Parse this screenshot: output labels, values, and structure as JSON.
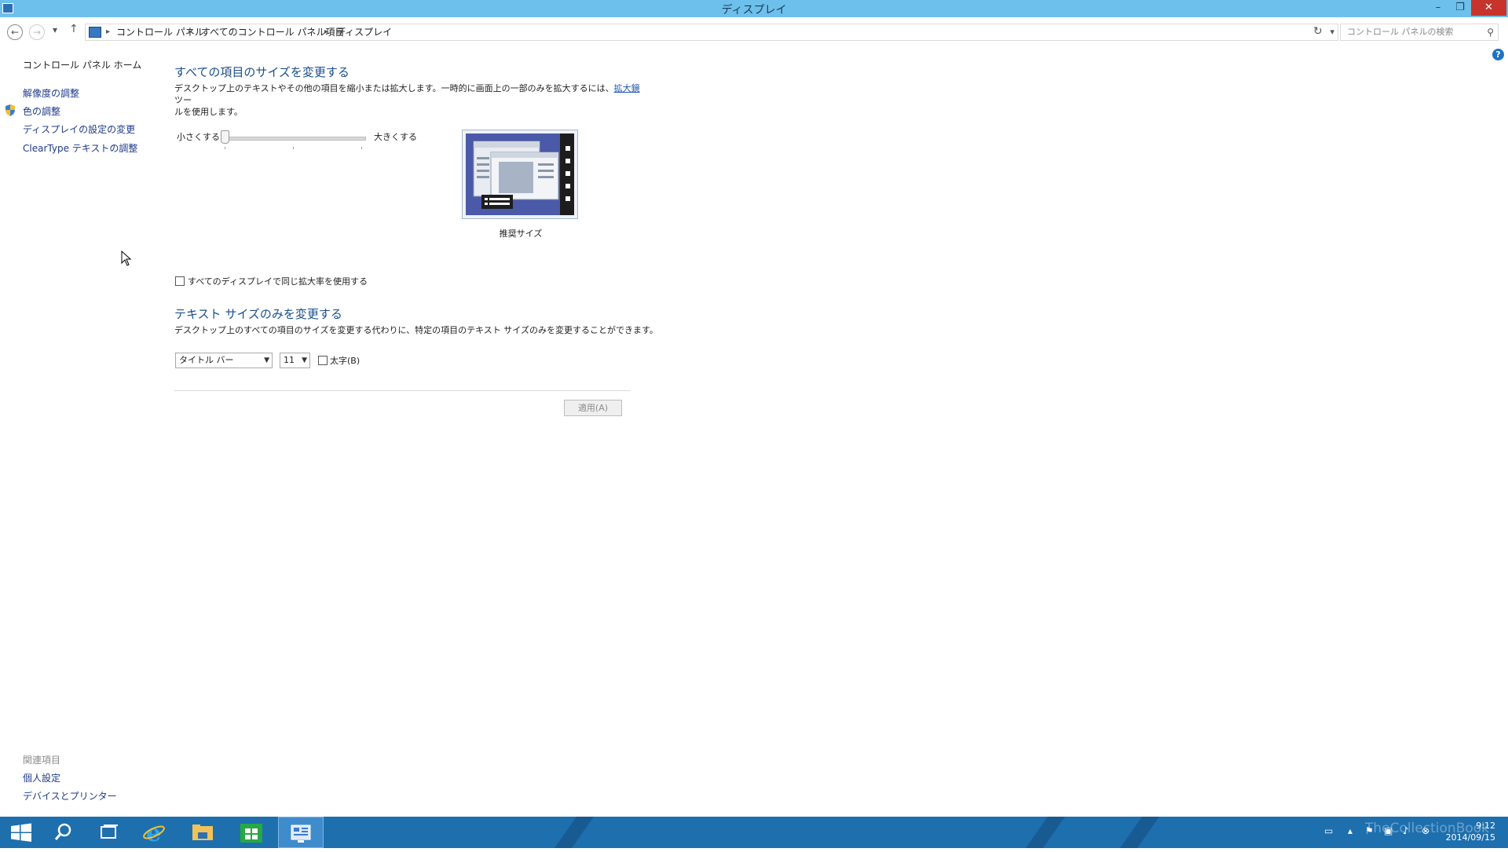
{
  "window": {
    "title": "ディスプレイ"
  },
  "window_controls": {
    "minimize": "–",
    "maximize": "❐",
    "close": "✕"
  },
  "address": {
    "crumbs": [
      "コントロール パネル",
      "すべてのコントロール パネル項目",
      "ディスプレイ"
    ],
    "search_placeholder": "コントロール パネルの検索"
  },
  "sidebar": {
    "home": "コントロール パネル ホーム",
    "links": [
      "解像度の調整",
      "色の調整",
      "ディスプレイの設定の変更",
      "ClearType テキストの調整"
    ],
    "related_heading": "関連項目",
    "related_links": [
      "個人設定",
      "デバイスとプリンター"
    ]
  },
  "resize": {
    "heading": "すべての項目のサイズを変更する",
    "desc_line1_pre": "デスクトップ上のテキストやその他の項目を縮小または拡大します。一時的に画面上の一部のみを拡大するには、",
    "desc_link": "拡大鏡",
    "desc_line1_post": "ツー",
    "desc_line2": "ルを使用します。",
    "smaller": "小さくする",
    "larger": "大きくする",
    "slider_level": 0,
    "preview_caption": "推奨サイズ",
    "same_scale_label": "すべてのディスプレイで同じ拡大率を使用する",
    "same_scale_checked": false
  },
  "textsize": {
    "heading": "テキスト サイズのみを変更する",
    "desc": "デスクトップ上のすべての項目のサイズを変更する代わりに、特定の項目のテキスト サイズのみを変更することができます。",
    "item_select": "タイトル バー",
    "size_select": "11",
    "bold_label": "太字(B)",
    "bold_checked": false
  },
  "apply_label": "適用(A)",
  "taskbar": {
    "time": "9:12",
    "date": "2014/09/15",
    "watermark": "TheCollectionBook"
  },
  "colors": {
    "titlebar": "#6ec0ec",
    "taskbar": "#1e6fae",
    "accent_link": "#1a4f8c"
  }
}
